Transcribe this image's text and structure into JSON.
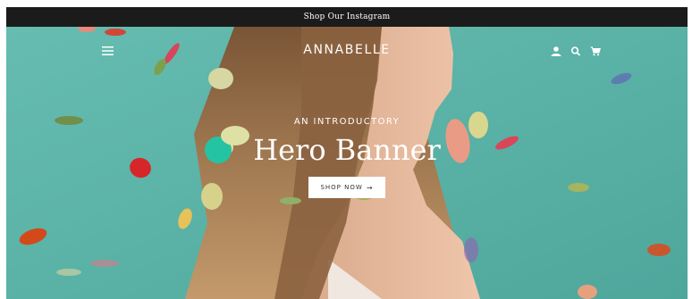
{
  "announcement": {
    "text": "Shop Our Instagram"
  },
  "header": {
    "brand": "ANNABELLE",
    "icons": [
      "menu-icon",
      "account-icon",
      "search-icon",
      "cart-icon"
    ]
  },
  "hero": {
    "subtitle": "AN INTRODUCTORY",
    "title": "Hero Banner",
    "button_label": "SHOP NOW",
    "button_arrow": "→"
  },
  "colors": {
    "announcement_bg": "#1b1b1b",
    "hero_bg": "#5fb4a9",
    "text_on_hero": "#ffffff",
    "button_bg": "#ffffff",
    "button_text": "#333333"
  }
}
